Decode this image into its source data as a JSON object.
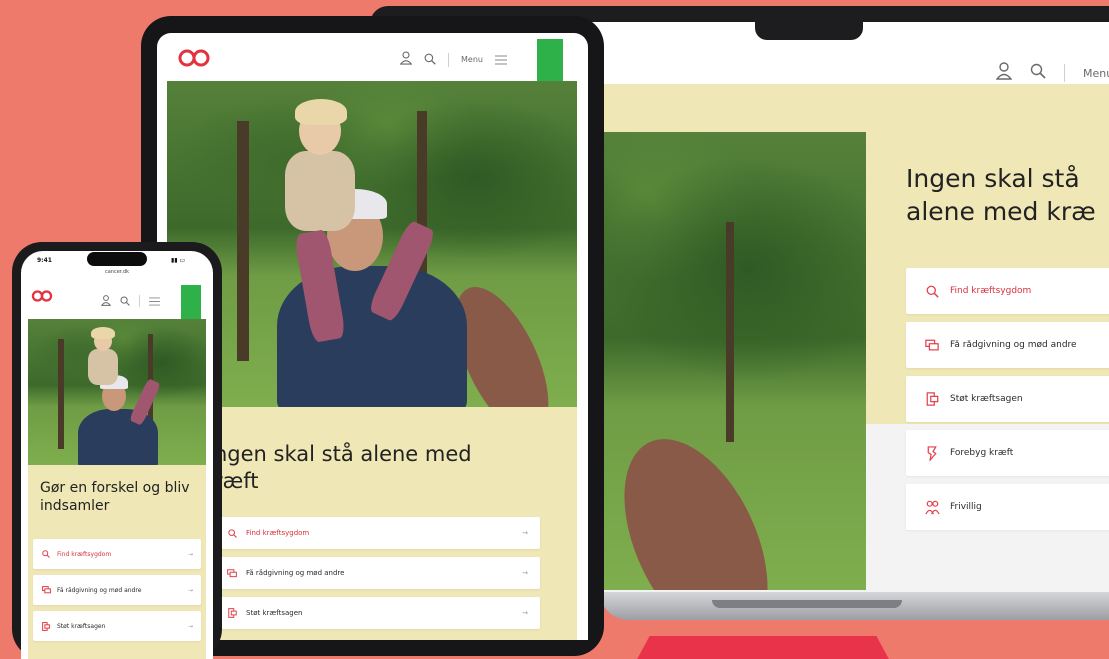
{
  "laptop": {
    "menu_label": "Menu",
    "hero_title_line1": "Ingen skal stå",
    "hero_title_line2": "alene med kræ",
    "links": [
      {
        "label": "Find kræftsygdom",
        "icon": "search-icon",
        "highlighted": true
      },
      {
        "label": "Få rådgivning og mød andre",
        "icon": "chat-icon",
        "highlighted": false
      },
      {
        "label": "Støt kræftsagen",
        "icon": "donate-icon",
        "highlighted": false
      },
      {
        "label": "Forebyg kræft",
        "icon": "prevent-icon",
        "highlighted": false
      },
      {
        "label": "Frivillig",
        "icon": "volunteer-icon",
        "highlighted": false
      }
    ]
  },
  "tablet": {
    "menu_label": "Menu",
    "hero_title_line1": "ngen skal stå alene med",
    "hero_title_line2": "ræft",
    "arrow": "→",
    "links": [
      {
        "label": "Find kræftsygdom",
        "icon": "search-icon",
        "highlighted": true
      },
      {
        "label": "Få rådgivning og mød andre",
        "icon": "chat-icon",
        "highlighted": false
      },
      {
        "label": "Støt kræftsagen",
        "icon": "donate-icon",
        "highlighted": false
      }
    ]
  },
  "phone": {
    "time": "9:41",
    "url": "cancer.dk",
    "hero_title": "Gør en forskel og bliv indsamler",
    "arrow": "→",
    "links": [
      {
        "label": "Find kræftsygdom",
        "icon": "search-icon",
        "highlighted": true
      },
      {
        "label": "Få rådgivning og mød andre",
        "icon": "chat-icon",
        "highlighted": false
      },
      {
        "label": "Støt kræftsagen",
        "icon": "donate-icon",
        "highlighted": false
      }
    ]
  },
  "colors": {
    "background": "#ee7a6c",
    "brand_red": "#e2313f",
    "cream": "#efe7b6",
    "green_tab": "#2fb14a"
  }
}
